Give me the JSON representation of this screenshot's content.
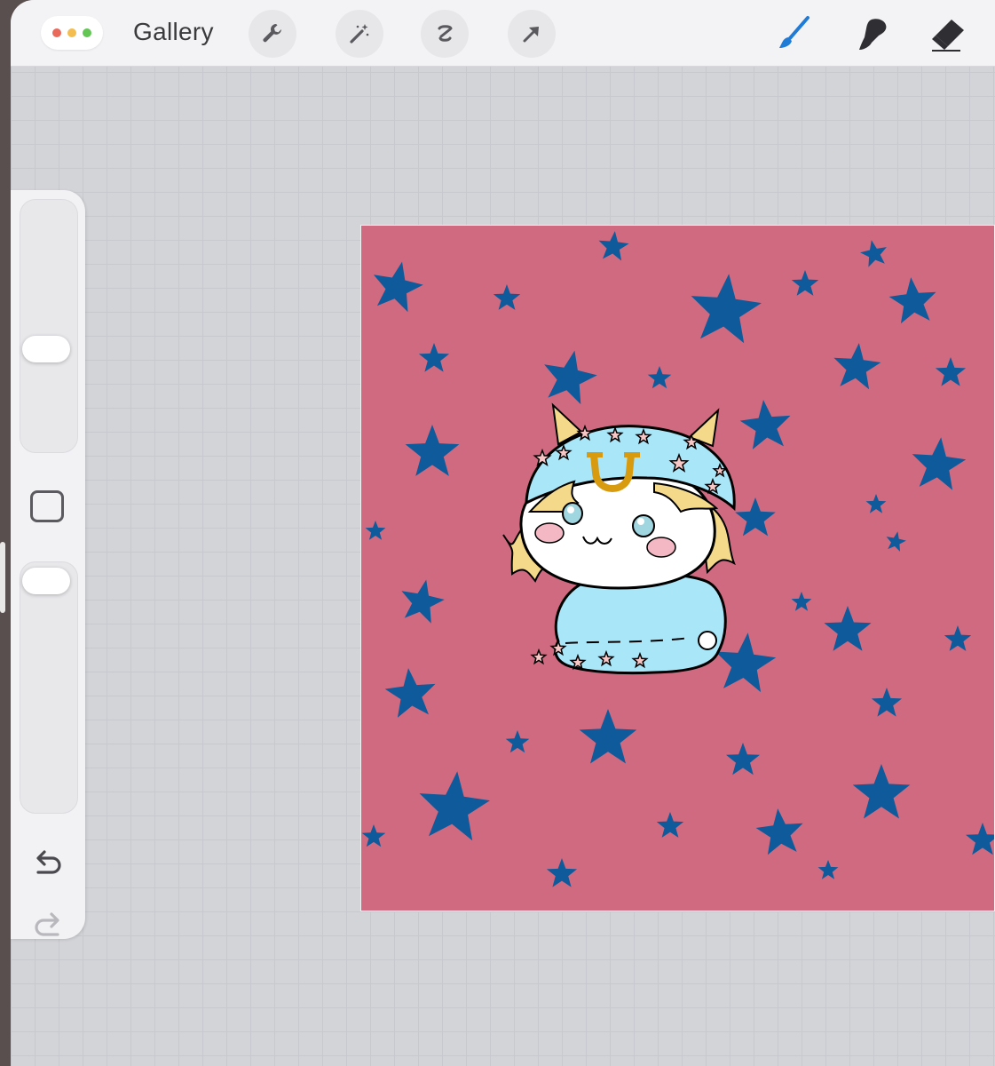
{
  "toolbar": {
    "gallery_label": "Gallery",
    "window_dots": [
      "#e96a5b",
      "#f4bd4f",
      "#62c554"
    ],
    "left_tools": [
      "wrench-icon",
      "magic-wand-icon",
      "selection-icon",
      "transform-arrow-icon"
    ],
    "right_tools": [
      "brush-icon",
      "smudge-icon",
      "eraser-icon"
    ],
    "active_tool": "brush-icon",
    "accent_color": "#1f7bd6"
  },
  "sidebar": {
    "brush_size_level": 0.45,
    "opacity_level": 0.05,
    "buttons": [
      "modify-button",
      "undo-button",
      "redo-button"
    ]
  },
  "canvas": {
    "background_color": "#d06a80",
    "star_color": "#0e5a9a"
  }
}
